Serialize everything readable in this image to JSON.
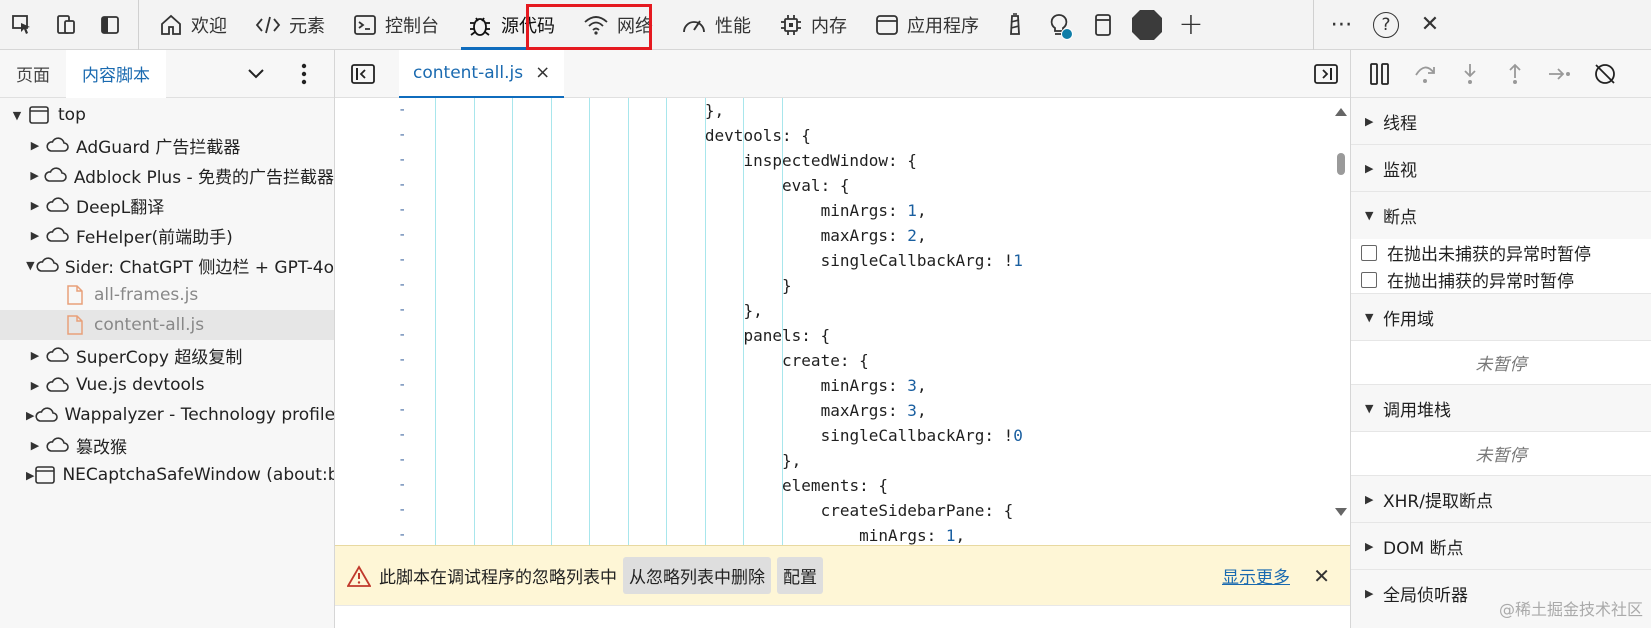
{
  "toolbar": {
    "tabs": [
      {
        "label": "欢迎",
        "icon": "home-icon"
      },
      {
        "label": "元素",
        "icon": "code-icon"
      },
      {
        "label": "控制台",
        "icon": "console-icon"
      },
      {
        "label": "源代码",
        "icon": "bug-icon",
        "active": true
      },
      {
        "label": "网络",
        "icon": "wifi-icon"
      },
      {
        "label": "性能",
        "icon": "gauge-icon"
      },
      {
        "label": "内存",
        "icon": "chip-icon"
      },
      {
        "label": "应用程序",
        "icon": "window-icon"
      }
    ],
    "help": "?",
    "add": "+"
  },
  "navigator": {
    "tabs": [
      "页面",
      "内容脚本"
    ],
    "active_tab": "内容脚本",
    "tree": [
      {
        "label": "top",
        "depth": 0,
        "expanded": true,
        "icon": "frame-icon"
      },
      {
        "label": "AdGuard 广告拦截器",
        "depth": 1,
        "icon": "cloud-icon"
      },
      {
        "label": "Adblock Plus - 免费的广告拦截器",
        "depth": 1,
        "icon": "cloud-icon"
      },
      {
        "label": "DeepL翻译",
        "depth": 1,
        "icon": "cloud-icon"
      },
      {
        "label": "FeHelper(前端助手)",
        "depth": 1,
        "icon": "cloud-icon"
      },
      {
        "label": "Sider: ChatGPT 侧边栏 + GPT-4o",
        "depth": 1,
        "expanded": true,
        "icon": "cloud-icon"
      },
      {
        "label": "all-frames.js",
        "depth": 2,
        "icon": "file-icon"
      },
      {
        "label": "content-all.js",
        "depth": 2,
        "icon": "file-icon",
        "selected": true
      },
      {
        "label": "SuperCopy 超级复制",
        "depth": 1,
        "icon": "cloud-icon"
      },
      {
        "label": "Vue.js devtools",
        "depth": 1,
        "icon": "cloud-icon"
      },
      {
        "label": "Wappalyzer - Technology profiler",
        "depth": 1,
        "icon": "cloud-icon"
      },
      {
        "label": "篡改猴",
        "depth": 1,
        "icon": "cloud-icon"
      },
      {
        "label": "NECaptchaSafeWindow (about:blank)",
        "depth": 1,
        "icon": "frame-icon"
      }
    ]
  },
  "editor": {
    "file_tab": "content-all.js",
    "close_glyph": "×",
    "gutter_mark": "-",
    "lines": [
      {
        "indent": 7,
        "text": "},"
      },
      {
        "indent": 7,
        "text": "devtools: {"
      },
      {
        "indent": 8,
        "text": "inspectedWindow: {"
      },
      {
        "indent": 9,
        "text": "eval: {"
      },
      {
        "indent": 10,
        "text": "minArgs: ",
        "num": "1",
        "tail": ","
      },
      {
        "indent": 10,
        "text": "maxArgs: ",
        "num": "2",
        "tail": ","
      },
      {
        "indent": 10,
        "text": "singleCallbackArg: !",
        "num": "1",
        "tail": ""
      },
      {
        "indent": 9,
        "text": "}"
      },
      {
        "indent": 8,
        "text": "},"
      },
      {
        "indent": 8,
        "text": "panels: {"
      },
      {
        "indent": 9,
        "text": "create: {"
      },
      {
        "indent": 10,
        "text": "minArgs: ",
        "num": "3",
        "tail": ","
      },
      {
        "indent": 10,
        "text": "maxArgs: ",
        "num": "3",
        "tail": ","
      },
      {
        "indent": 10,
        "text": "singleCallbackArg: !",
        "num": "0",
        "tail": ""
      },
      {
        "indent": 9,
        "text": "},"
      },
      {
        "indent": 9,
        "text": "elements: {"
      },
      {
        "indent": 10,
        "text": "createSidebarPane: {"
      },
      {
        "indent": 11,
        "text": "minArgs: ",
        "num": "1",
        "tail": ","
      }
    ],
    "banner": {
      "message": "此脚本在调试程序的忽略列表中",
      "remove_button": "从忽略列表中删除",
      "config_button": "配置",
      "more_link": "显示更多"
    }
  },
  "debugger": {
    "sections": {
      "threads": "线程",
      "watch": "监视",
      "breakpoints": "断点",
      "scope": "作用域",
      "callstack": "调用堆栈",
      "xhr": "XHR/提取断点",
      "dom": "DOM 断点",
      "listeners": "全局侦听器"
    },
    "checkboxes": [
      "在抛出未捕获的异常时暂停",
      "在抛出捕获的异常时暂停"
    ],
    "not_paused": "未暂停"
  },
  "watermark": "@稀土掘金技术社区"
}
